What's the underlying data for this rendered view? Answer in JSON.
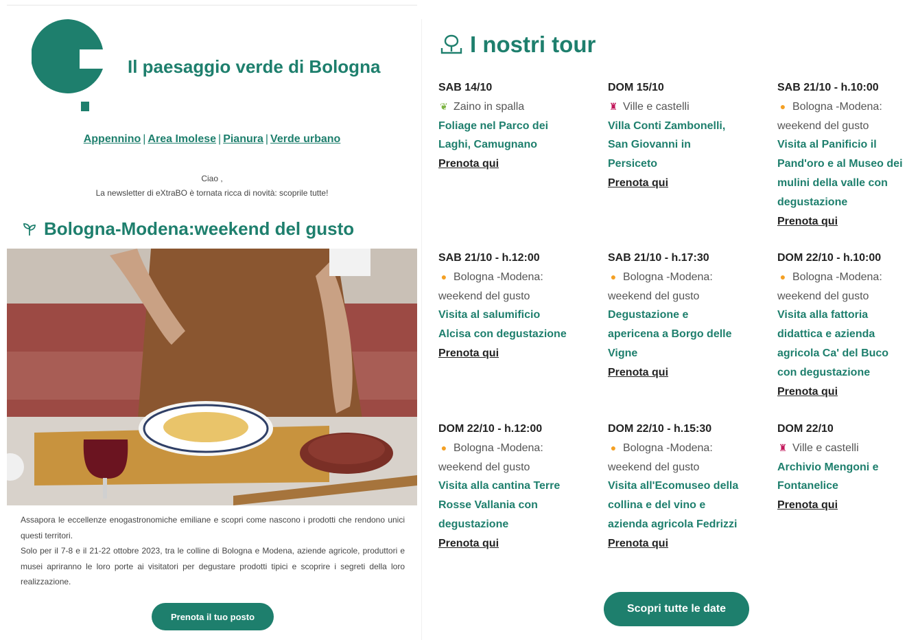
{
  "header": {
    "brand_title": "Il paesaggio verde di Bologna",
    "nav": [
      "Appennino",
      "Area Imolese",
      "Pianura",
      "Verde urbano"
    ],
    "greeting": "Ciao ,",
    "intro": "La newsletter di eXtraBO è tornata ricca di novità: scoprile tutte!"
  },
  "feature": {
    "title": "Bologna-Modena:weekend del gusto",
    "paragraph1": "Assapora le eccellenze enogastronomiche emiliane e scopri come nascono i prodotti che rendono unici questi territori.",
    "paragraph2": "Solo per il 7-8 e il 21-22 ottobre 2023, tra le colline di Bologna e Modena, aziende agricole, produttori e musei apriranno le loro porte ai visitatori per degustare prodotti tipici e scoprire i segreti della loro realizzazione.",
    "cta": "Prenota il tuo posto"
  },
  "tours": {
    "title": "I nostri tour",
    "book_label": "Prenota qui",
    "cta": "Scopri tutte le date",
    "items": [
      {
        "date": "SAB 14/10",
        "category": "Zaino in spalla",
        "icon": "leaf",
        "title": "Foliage nel Parco dei Laghi, Camugnano"
      },
      {
        "date": "DOM 15/10",
        "category": "Ville e castelli",
        "icon": "castle",
        "title": "Villa Conti Zambonelli, San Giovanni in Persiceto"
      },
      {
        "date": "SAB 21/10 - h.10:00",
        "category": "Bologna -Modena: weekend del gusto",
        "icon": "yum",
        "title": "Visita al Panificio il Pand'oro e al Museo dei mulini della valle con degustazione"
      },
      {
        "date": "SAB 21/10 - h.12:00",
        "category": "Bologna -Modena: weekend del gusto",
        "icon": "yum",
        "title": " Visita al salumificio Alcisa con degustazione"
      },
      {
        "date": "SAB 21/10 - h.17:30",
        "category": "Bologna -Modena: weekend del gusto",
        "icon": "yum",
        "title": "Degustazione e apericena a Borgo delle Vigne"
      },
      {
        "date": "DOM 22/10 - h.10:00",
        "category": "Bologna -Modena: weekend del gusto",
        "icon": "yum",
        "title": "Visita alla fattoria didattica e azienda agricola Ca' del Buco con degustazione"
      },
      {
        "date": "DOM 22/10 - h.12:00",
        "category": "Bologna -Modena: weekend del gusto",
        "icon": "yum",
        "title": "Visita alla cantina Terre Rosse Vallania con degustazione"
      },
      {
        "date": "DOM 22/10 - h.15:30",
        "category": "Bologna -Modena: weekend del gusto",
        "icon": "yum",
        "title": "Visita all'Ecomuseo della collina e del vino e azienda agricola Fedrizzi"
      },
      {
        "date": "DOM 22/10",
        "category": "Ville e castelli",
        "icon": "castle",
        "title": "Archivio Mengoni e Fontanelice"
      }
    ]
  },
  "colors": {
    "accent": "#1e7f6d"
  }
}
